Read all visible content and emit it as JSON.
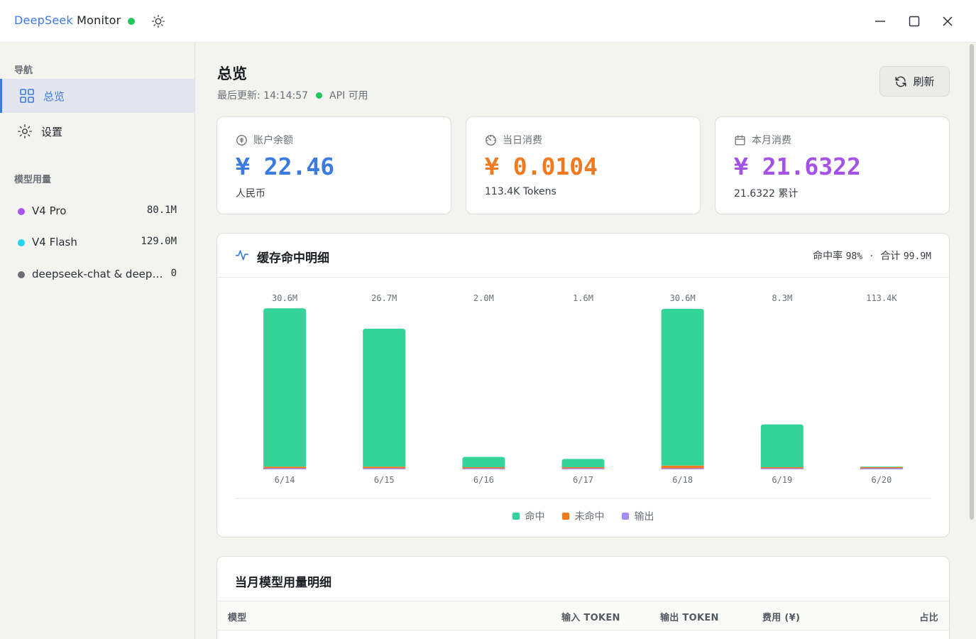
{
  "titlebar": {
    "brand": "DeepSeek",
    "title_rest": " Monitor",
    "status_color": "#22c55e",
    "icons": {
      "theme": "sun-icon",
      "minimize": "minimize-icon",
      "maximize": "maximize-icon",
      "close": "close-icon"
    }
  },
  "sidebar": {
    "nav_heading": "导航",
    "nav_items": [
      {
        "label": "总览",
        "icon": "grid-icon",
        "active": true
      },
      {
        "label": "设置",
        "icon": "gear-icon",
        "active": false
      }
    ],
    "models_heading": "模型用量",
    "models": [
      {
        "name": "V4 Pro",
        "value": "80.1M",
        "color": "#a855f7"
      },
      {
        "name": "V4 Flash",
        "value": "129.0M",
        "color": "#22d3ee"
      },
      {
        "name": "deepseek-chat & deepseek-reasoner",
        "value": "0",
        "color": "#6b6f76"
      }
    ]
  },
  "header": {
    "title": "总览",
    "last_updated_label": "最后更新: 14:14:57",
    "api_status": "API 可用",
    "refresh_label": "刷新"
  },
  "stats": [
    {
      "label": "账户余额",
      "icon": "coin-icon",
      "value": "¥ 22.46",
      "sub": "人民币",
      "color": "#3b7be0"
    },
    {
      "label": "当日消费",
      "icon": "clock-icon",
      "value": "¥ 0.0104",
      "sub": "113.4K Tokens",
      "color": "#f07a1f"
    },
    {
      "label": "本月消费",
      "icon": "calendar-icon",
      "value": "¥ 21.6322",
      "sub": "21.6322 累计",
      "color": "#a451e6"
    }
  ],
  "cache_chart": {
    "title": "缓存命中明细",
    "hit_rate_label": "命中率",
    "hit_rate": "98%",
    "separator": "·",
    "total_label": "合计",
    "total": "99.9M"
  },
  "chart_data": {
    "type": "bar",
    "stacked": true,
    "categories": [
      "6/14",
      "6/15",
      "6/16",
      "6/17",
      "6/18",
      "6/19",
      "6/20"
    ],
    "value_labels": [
      "30.6M",
      "26.7M",
      "2.0M",
      "1.6M",
      "30.6M",
      "8.3M",
      "113.4K"
    ],
    "series": [
      {
        "name": "命中",
        "color": "#34d399",
        "values": [
          30.2,
          26.3,
          1.97,
          1.57,
          29.9,
          8.15,
          0.11
        ]
      },
      {
        "name": "未命中",
        "color": "#f07a1f",
        "values": [
          0.3,
          0.3,
          0.02,
          0.02,
          0.5,
          0.12,
          0.002
        ]
      },
      {
        "name": "输出",
        "color": "#a78bfa",
        "values": [
          0.1,
          0.1,
          0.01,
          0.01,
          0.2,
          0.03,
          0.001
        ]
      }
    ],
    "ylim": [
      0,
      30.6
    ],
    "unit": "M",
    "legend_position": "bottom-center",
    "grid": false
  },
  "table": {
    "title": "当月模型用量明细",
    "columns": [
      "模型",
      "输入 TOKEN",
      "输出 TOKEN",
      "费用 (¥)",
      "占比"
    ]
  }
}
